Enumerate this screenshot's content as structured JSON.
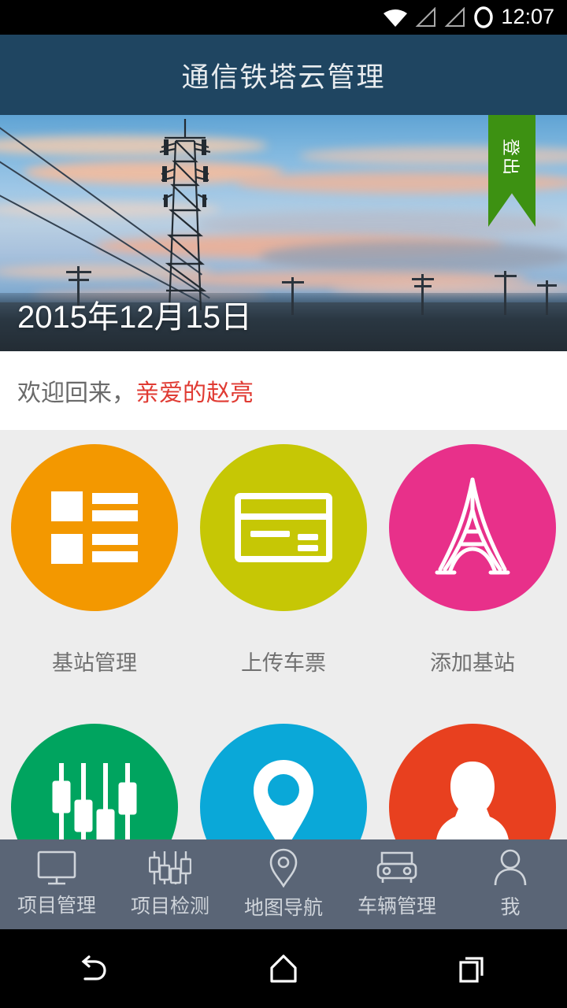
{
  "status_bar": {
    "time": "12:07",
    "icons": [
      "wifi-icon",
      "signal-icon-1",
      "signal-icon-2",
      "circle-icon"
    ]
  },
  "app_bar": {
    "title": "通信铁塔云管理"
  },
  "hero": {
    "date": "2015年12月15日",
    "image_alt": "telecom-tower-sunset-photo",
    "ribbon": {
      "label": "登出",
      "color": "#3d9112"
    }
  },
  "welcome": {
    "prefix": "欢迎回来，",
    "user": "亲爱的赵亮",
    "prefix_color": "#6a6a6a",
    "user_color": "#e03b33"
  },
  "grid": {
    "items": [
      {
        "label": "基站管理",
        "icon": "list-grid-icon",
        "color": "#f39800"
      },
      {
        "label": "上传车票",
        "icon": "credit-card-icon",
        "color": "#c6c705"
      },
      {
        "label": "添加基站",
        "icon": "tower-icon",
        "color": "#e8308a"
      },
      {
        "label": "",
        "icon": "sliders-icon",
        "color": "#00a45f"
      },
      {
        "label": "",
        "icon": "map-pin-icon",
        "color": "#0aa8d8"
      },
      {
        "label": "",
        "icon": "person-icon",
        "color": "#e8401f"
      }
    ]
  },
  "tab_bar": {
    "background": "#5a6576",
    "items": [
      {
        "label": "项目管理",
        "icon": "monitor-icon"
      },
      {
        "label": "项目检测",
        "icon": "sliders-icon"
      },
      {
        "label": "地图导航",
        "icon": "map-pin-outline-icon"
      },
      {
        "label": "车辆管理",
        "icon": "car-icon"
      },
      {
        "label": "我",
        "icon": "person-outline-icon"
      }
    ]
  },
  "nav_bar": {
    "buttons": [
      {
        "name": "back-button",
        "icon": "back-arrow-icon"
      },
      {
        "name": "home-button",
        "icon": "home-icon"
      },
      {
        "name": "recents-button",
        "icon": "recents-icon"
      }
    ]
  }
}
